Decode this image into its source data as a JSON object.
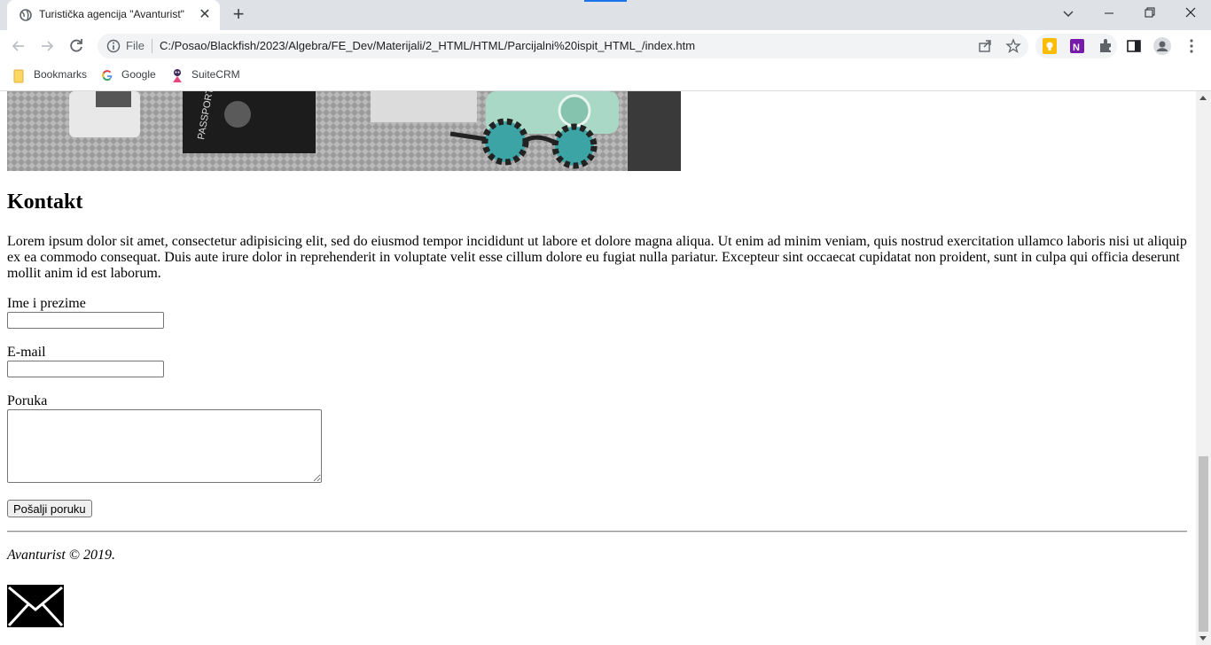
{
  "browser": {
    "tab_title": "Turistička agencija \"Avanturist\"",
    "omnibox_scheme": "File",
    "url": "C:/Posao/Blackfish/2023/Algebra/FE_Dev/Materijali/2_HTML/HTML/Parcijalni%20ispit_HTML_/index.htm",
    "bookmarks": [
      "Bookmarks",
      "Google",
      "SuiteCRM"
    ]
  },
  "page": {
    "heading": "Kontakt",
    "paragraph": "Lorem ipsum dolor sit amet, consectetur adipisicing elit, sed do eiusmod tempor incididunt ut labore et dolore magna aliqua. Ut enim ad minim veniam, quis nostrud exercitation ullamco laboris nisi ut aliquip ex ea commodo consequat. Duis aute irure dolor in reprehenderit in voluptate velit esse cillum dolore eu fugiat nulla pariatur. Excepteur sint occaecat cupidatat non proident, sunt in culpa qui officia deserunt mollit anim id est laborum.",
    "form": {
      "name_label": "Ime i prezime",
      "name_value": "",
      "email_label": "E-mail",
      "email_value": "",
      "message_label": "Poruka",
      "message_value": "",
      "submit_label": "Pošalji poruku"
    },
    "footer_text": "Avanturist © 2019.",
    "hero_passport_text": "PASSPORT"
  },
  "icons": [
    "globe-icon",
    "close-icon",
    "plus-icon",
    "chevron-down-icon",
    "minimize-icon",
    "restore-icon",
    "back-icon",
    "forward-icon",
    "reload-icon",
    "info-icon",
    "share-icon",
    "star-icon",
    "keep-icon",
    "onenote-icon",
    "puzzle-icon",
    "side-panel-icon",
    "profile-icon",
    "menu-icon",
    "folder-icon",
    "google-icon",
    "suitecrm-icon",
    "envelope-icon"
  ]
}
